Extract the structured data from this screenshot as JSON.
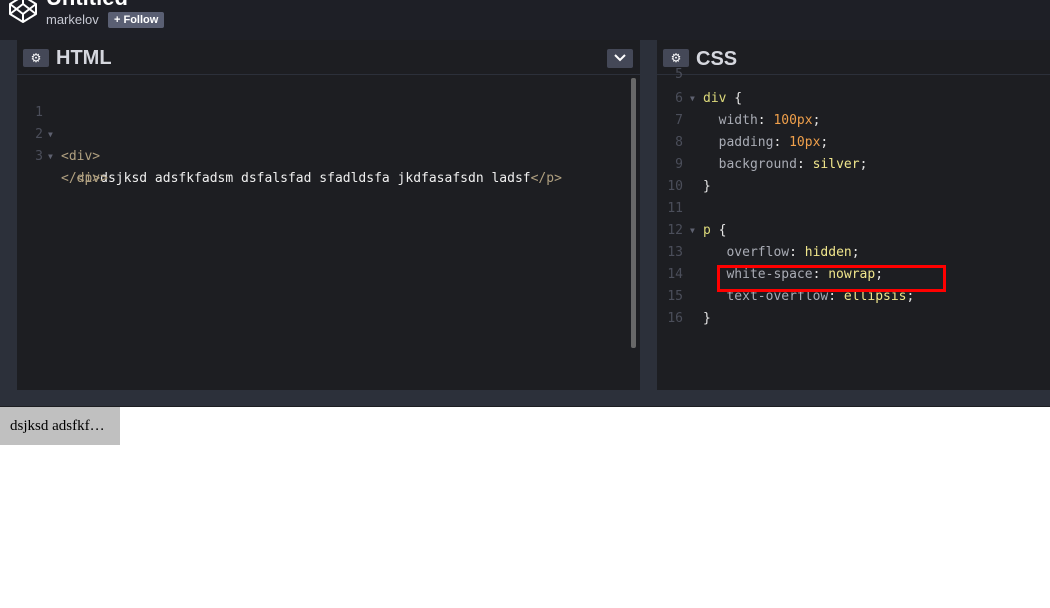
{
  "header": {
    "title": "Untitled",
    "username": "markelov",
    "follow_label": "+ Follow",
    "logo_icon": "codepen-logo-icon"
  },
  "html_editor": {
    "title": "HTML",
    "gear_icon": "gear-icon",
    "dropdown_icon": "chevron-down-icon",
    "lines": [
      {
        "n": "1",
        "code": "<div>"
      },
      {
        "n": "2",
        "code": "  <p>dsjksd adsfkfadsm dsfalsfad sfadldsfa jkdfasafsdn ladsf</p>"
      },
      {
        "n": "3",
        "code": "</div>"
      }
    ]
  },
  "css_editor": {
    "title": "CSS",
    "gear_icon": "gear-icon",
    "lines": [
      {
        "n": "5",
        "code": ""
      },
      {
        "n": "6",
        "code": "div {"
      },
      {
        "n": "7",
        "code": "  width: 100px;"
      },
      {
        "n": "8",
        "code": "  padding: 10px;"
      },
      {
        "n": "9",
        "code": "  background: silver;"
      },
      {
        "n": "10",
        "code": "}"
      },
      {
        "n": "11",
        "code": ""
      },
      {
        "n": "12",
        "code": "p {"
      },
      {
        "n": "13",
        "code": "   overflow: hidden;"
      },
      {
        "n": "14",
        "code": "   white-space: nowrap;"
      },
      {
        "n": "15",
        "code": "   text-overflow: ellipsis;"
      },
      {
        "n": "16",
        "code": "}"
      }
    ]
  },
  "preview": {
    "text": "dsjksd adsfkfadsm dsfalsfad sfadldsfa jkdfasafsdn ladsf"
  },
  "colors": {
    "header_bg": "#1e1f26",
    "editor_bg": "#1d1e22",
    "highlight": "#ff0000",
    "preview_box": "#c0c0c0"
  }
}
